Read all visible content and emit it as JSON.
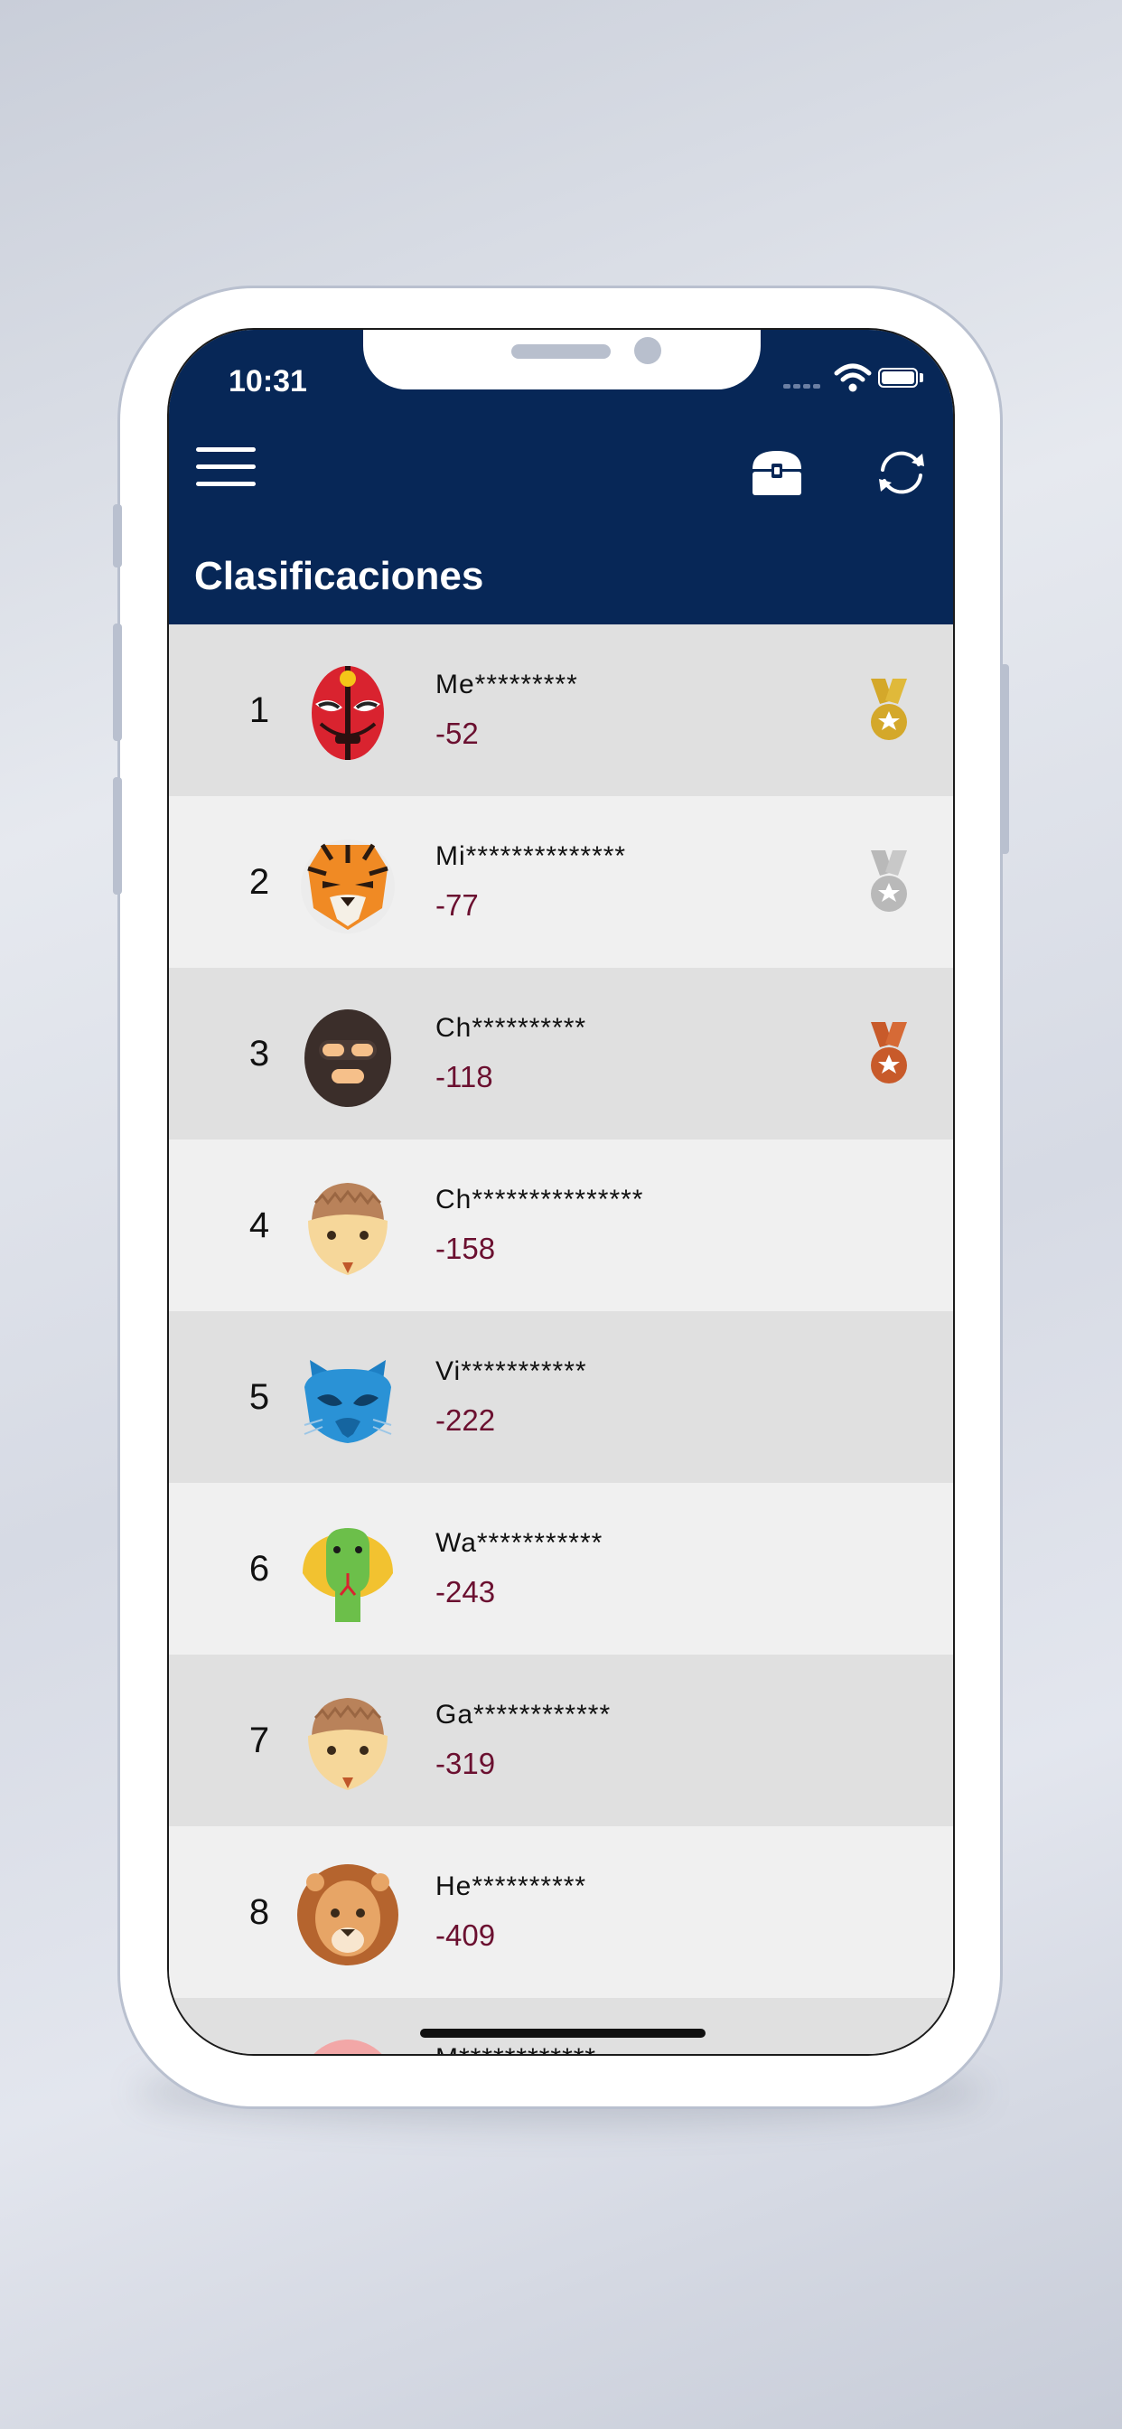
{
  "status_bar": {
    "time": "10:31"
  },
  "header": {
    "title": "Clasificaciones"
  },
  "colors": {
    "navbar": "#072757",
    "score": "#6b1030",
    "gold": "#d4a82a",
    "silver": "#b9b9b9",
    "bronze": "#c85a2a"
  },
  "leaderboard": [
    {
      "rank": "1",
      "name": "Me*********",
      "score": "-52",
      "avatar": "red-luchador-mask-icon",
      "medal": "gold"
    },
    {
      "rank": "2",
      "name": "Mi**************",
      "score": "-77",
      "avatar": "tiger-mask-icon",
      "medal": "silver"
    },
    {
      "rank": "3",
      "name": "Ch**********",
      "score": "-118",
      "avatar": "balaclava-mask-icon",
      "medal": "bronze"
    },
    {
      "rank": "4",
      "name": "Ch***************",
      "score": "-158",
      "avatar": "hedgehog-mask-icon",
      "medal": ""
    },
    {
      "rank": "5",
      "name": "Vi***********",
      "score": "-222",
      "avatar": "blue-cat-mask-icon",
      "medal": ""
    },
    {
      "rank": "6",
      "name": "Wa***********",
      "score": "-243",
      "avatar": "cobra-mask-icon",
      "medal": ""
    },
    {
      "rank": "7",
      "name": "Ga************",
      "score": "-319",
      "avatar": "hedgehog-mask-icon",
      "medal": ""
    },
    {
      "rank": "8",
      "name": "He**********",
      "score": "-409",
      "avatar": "lion-mask-icon",
      "medal": ""
    },
    {
      "rank": "",
      "name": "M************",
      "score": "",
      "avatar": "pink-mask-icon",
      "medal": ""
    }
  ]
}
